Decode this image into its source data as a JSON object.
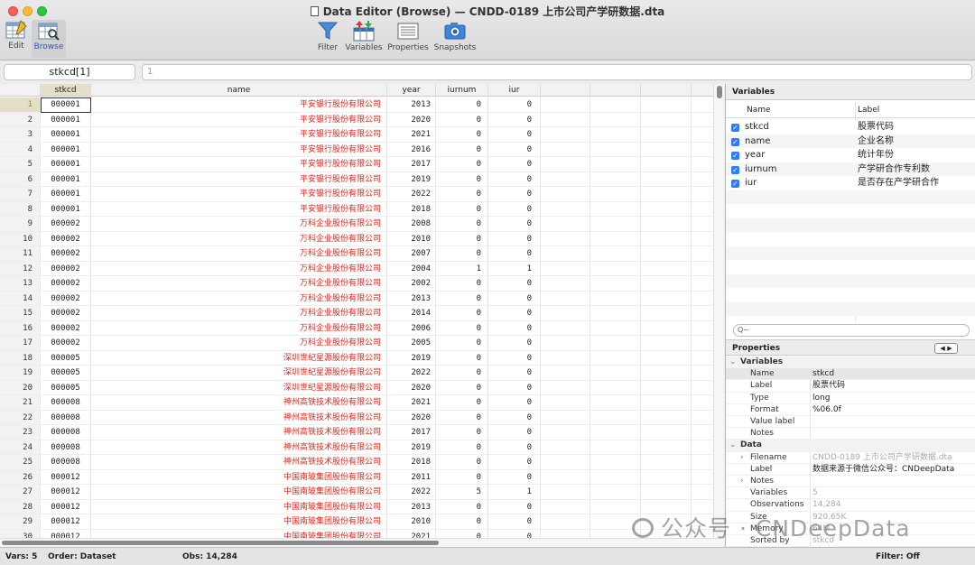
{
  "window": {
    "title": "Data Editor (Browse) — CNDD-0189 上市公司产学研数据.dta"
  },
  "toolbar": {
    "edit": "Edit",
    "browse": "Browse",
    "filter": "Filter",
    "variables": "Variables",
    "properties": "Properties",
    "snapshots": "Snapshots"
  },
  "command": {
    "varname": "stkcd[1]",
    "value": "1"
  },
  "grid": {
    "columns": [
      "stkcd",
      "name",
      "year",
      "iurnum",
      "iur"
    ],
    "rows": [
      {
        "n": "1",
        "stkcd": "000001",
        "name": "平安银行股份有限公司",
        "year": "2013",
        "iurnum": "0",
        "iur": "0"
      },
      {
        "n": "2",
        "stkcd": "000001",
        "name": "平安银行股份有限公司",
        "year": "2020",
        "iurnum": "0",
        "iur": "0"
      },
      {
        "n": "3",
        "stkcd": "000001",
        "name": "平安银行股份有限公司",
        "year": "2021",
        "iurnum": "0",
        "iur": "0"
      },
      {
        "n": "4",
        "stkcd": "000001",
        "name": "平安银行股份有限公司",
        "year": "2016",
        "iurnum": "0",
        "iur": "0"
      },
      {
        "n": "5",
        "stkcd": "000001",
        "name": "平安银行股份有限公司",
        "year": "2017",
        "iurnum": "0",
        "iur": "0"
      },
      {
        "n": "6",
        "stkcd": "000001",
        "name": "平安银行股份有限公司",
        "year": "2019",
        "iurnum": "0",
        "iur": "0"
      },
      {
        "n": "7",
        "stkcd": "000001",
        "name": "平安银行股份有限公司",
        "year": "2022",
        "iurnum": "0",
        "iur": "0"
      },
      {
        "n": "8",
        "stkcd": "000001",
        "name": "平安银行股份有限公司",
        "year": "2018",
        "iurnum": "0",
        "iur": "0"
      },
      {
        "n": "9",
        "stkcd": "000002",
        "name": "万科企业股份有限公司",
        "year": "2008",
        "iurnum": "0",
        "iur": "0"
      },
      {
        "n": "10",
        "stkcd": "000002",
        "name": "万科企业股份有限公司",
        "year": "2010",
        "iurnum": "0",
        "iur": "0"
      },
      {
        "n": "11",
        "stkcd": "000002",
        "name": "万科企业股份有限公司",
        "year": "2007",
        "iurnum": "0",
        "iur": "0"
      },
      {
        "n": "12",
        "stkcd": "000002",
        "name": "万科企业股份有限公司",
        "year": "2004",
        "iurnum": "1",
        "iur": "1"
      },
      {
        "n": "13",
        "stkcd": "000002",
        "name": "万科企业股份有限公司",
        "year": "2002",
        "iurnum": "0",
        "iur": "0"
      },
      {
        "n": "14",
        "stkcd": "000002",
        "name": "万科企业股份有限公司",
        "year": "2013",
        "iurnum": "0",
        "iur": "0"
      },
      {
        "n": "15",
        "stkcd": "000002",
        "name": "万科企业股份有限公司",
        "year": "2014",
        "iurnum": "0",
        "iur": "0"
      },
      {
        "n": "16",
        "stkcd": "000002",
        "name": "万科企业股份有限公司",
        "year": "2006",
        "iurnum": "0",
        "iur": "0"
      },
      {
        "n": "17",
        "stkcd": "000002",
        "name": "万科企业股份有限公司",
        "year": "2005",
        "iurnum": "0",
        "iur": "0"
      },
      {
        "n": "18",
        "stkcd": "000005",
        "name": "深圳世纪星源股份有限公司",
        "year": "2019",
        "iurnum": "0",
        "iur": "0"
      },
      {
        "n": "19",
        "stkcd": "000005",
        "name": "深圳世纪星源股份有限公司",
        "year": "2022",
        "iurnum": "0",
        "iur": "0"
      },
      {
        "n": "20",
        "stkcd": "000005",
        "name": "深圳世纪星源股份有限公司",
        "year": "2020",
        "iurnum": "0",
        "iur": "0"
      },
      {
        "n": "21",
        "stkcd": "000008",
        "name": "神州高铁技术股份有限公司",
        "year": "2021",
        "iurnum": "0",
        "iur": "0"
      },
      {
        "n": "22",
        "stkcd": "000008",
        "name": "神州高铁技术股份有限公司",
        "year": "2020",
        "iurnum": "0",
        "iur": "0"
      },
      {
        "n": "23",
        "stkcd": "000008",
        "name": "神州高铁技术股份有限公司",
        "year": "2017",
        "iurnum": "0",
        "iur": "0"
      },
      {
        "n": "24",
        "stkcd": "000008",
        "name": "神州高铁技术股份有限公司",
        "year": "2019",
        "iurnum": "0",
        "iur": "0"
      },
      {
        "n": "25",
        "stkcd": "000008",
        "name": "神州高铁技术股份有限公司",
        "year": "2018",
        "iurnum": "0",
        "iur": "0"
      },
      {
        "n": "26",
        "stkcd": "000012",
        "name": "中国南玻集团股份有限公司",
        "year": "2011",
        "iurnum": "0",
        "iur": "0"
      },
      {
        "n": "27",
        "stkcd": "000012",
        "name": "中国南玻集团股份有限公司",
        "year": "2022",
        "iurnum": "5",
        "iur": "1"
      },
      {
        "n": "28",
        "stkcd": "000012",
        "name": "中国南玻集团股份有限公司",
        "year": "2013",
        "iurnum": "0",
        "iur": "0"
      },
      {
        "n": "29",
        "stkcd": "000012",
        "name": "中国南玻集团股份有限公司",
        "year": "2010",
        "iurnum": "0",
        "iur": "0"
      },
      {
        "n": "30",
        "stkcd": "000012",
        "name": "中国南玻集团股份有限公司",
        "year": "2021",
        "iurnum": "0",
        "iur": "0"
      }
    ]
  },
  "variables_panel": {
    "title": "Variables",
    "col_name": "Name",
    "col_label": "Label",
    "items": [
      {
        "name": "stkcd",
        "label": "股票代码"
      },
      {
        "name": "name",
        "label": "企业名称"
      },
      {
        "name": "year",
        "label": "统计年份"
      },
      {
        "name": "iurnum",
        "label": "产学研合作专利数"
      },
      {
        "name": "iur",
        "label": "是否存在产学研合作"
      }
    ],
    "filter_placeholder": "Q~"
  },
  "properties_panel": {
    "title": "Properties",
    "nav": "◀ ▶",
    "sec_variables": "Variables",
    "sec_data": "Data",
    "variable": [
      {
        "k": "Name",
        "v": "stkcd"
      },
      {
        "k": "Label",
        "v": "股票代码"
      },
      {
        "k": "Type",
        "v": "long"
      },
      {
        "k": "Format",
        "v": "%06.0f"
      },
      {
        "k": "Value label",
        "v": ""
      },
      {
        "k": "Notes",
        "v": ""
      }
    ],
    "data": [
      {
        "k": "Filename",
        "v": "CNDD-0189 上市公司产学研数据.dta"
      },
      {
        "k": "Label",
        "v": "数据来源于微信公众号：CNDeepData"
      },
      {
        "k": "Notes",
        "v": ""
      },
      {
        "k": "Variables",
        "v": "5"
      },
      {
        "k": "Observations",
        "v": "14,284"
      },
      {
        "k": "Size",
        "v": "920.65K"
      },
      {
        "k": "Memory",
        "v": "64M"
      },
      {
        "k": "Sorted by",
        "v": "stkcd"
      }
    ]
  },
  "status": {
    "vars": "Vars: 5",
    "order": "Order: Dataset",
    "obs": "Obs: 14,284",
    "filter": "Filter: Off"
  },
  "watermark": "公众号 · CNDeepData"
}
